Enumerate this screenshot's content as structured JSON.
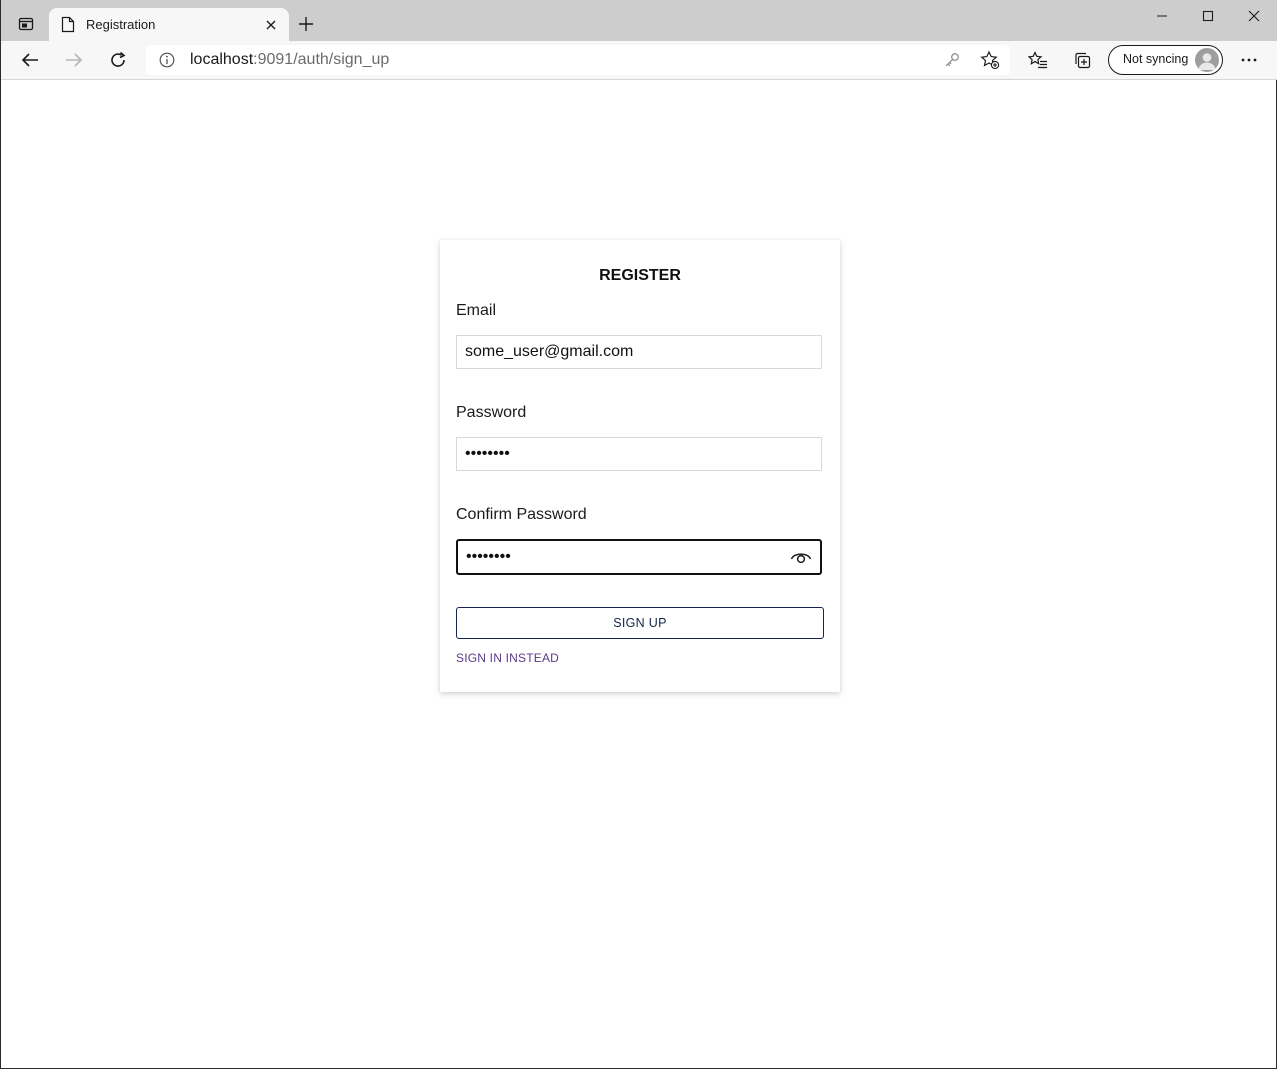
{
  "browser": {
    "tab": {
      "title": "Registration"
    },
    "address": {
      "host": "localhost",
      "path": ":9091/auth/sign_up"
    },
    "sync": {
      "label": "Not syncing"
    }
  },
  "form": {
    "title": "REGISTER",
    "email": {
      "label": "Email",
      "value": "some_user@gmail.com"
    },
    "password": {
      "label": "Password",
      "value": "••••••••"
    },
    "confirm": {
      "label": "Confirm Password",
      "value": "••••••••"
    },
    "submit_label": "SIGN UP",
    "alt_link": "SIGN IN INSTEAD"
  },
  "colors": {
    "accent": "#14264f",
    "link": "#5b3a87",
    "chrome": "#cdcdcd",
    "toolbar": "#f7f7f7"
  }
}
